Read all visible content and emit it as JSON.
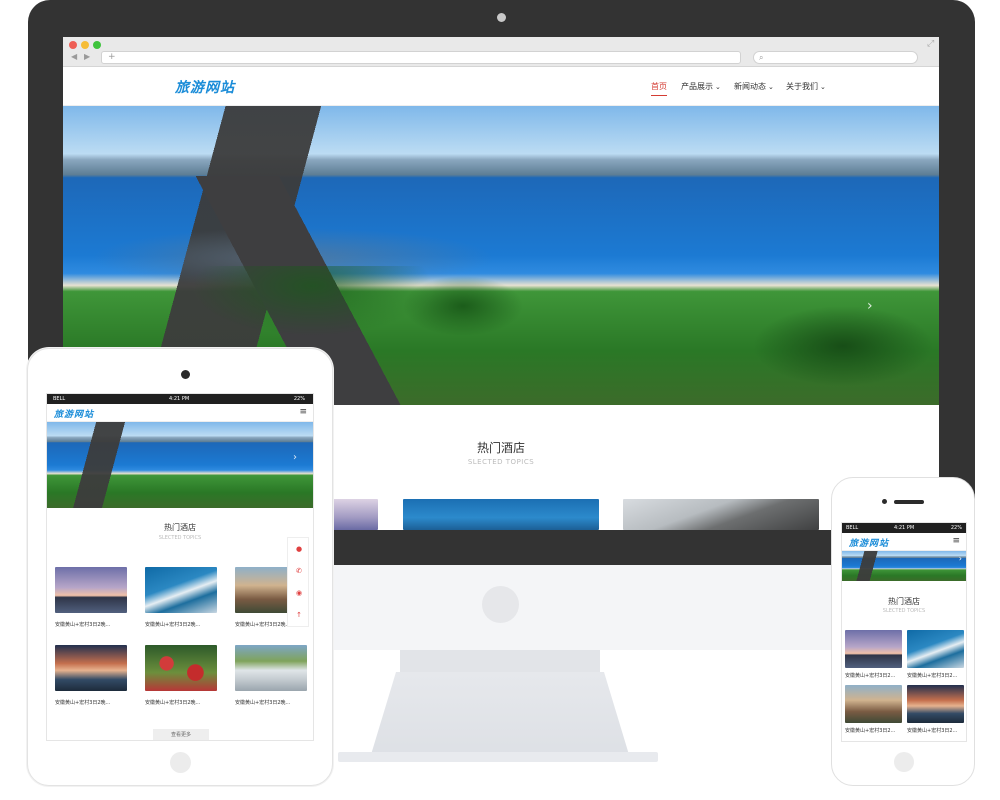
{
  "site": {
    "logo": "旅游网站",
    "nav": [
      {
        "label": "首页",
        "active": true,
        "has_dropdown": false
      },
      {
        "label": "产品展示",
        "active": false,
        "has_dropdown": true
      },
      {
        "label": "新闻动态",
        "active": false,
        "has_dropdown": true
      },
      {
        "label": "关于我们",
        "active": false,
        "has_dropdown": true
      }
    ],
    "section_title": "热门酒店",
    "section_subtitle": "SLECTED TOPICS"
  },
  "browser": {
    "url_placeholder": "+",
    "search_icon": "search-icon",
    "dot_colors": [
      "#ee5f56",
      "#f6bd38",
      "#3fc43d"
    ]
  },
  "status_bar": {
    "carrier": "BELL",
    "time": "4:21 PM",
    "battery": "22%"
  },
  "tablet": {
    "cards": [
      {
        "caption": "安徽黄山+宏村3日2晚..."
      },
      {
        "caption": "安徽黄山+宏村3日2晚..."
      },
      {
        "caption": "安徽黄山+宏村3日2晚..."
      },
      {
        "caption": "安徽黄山+宏村3日2晚..."
      },
      {
        "caption": "安徽黄山+宏村3日2晚..."
      },
      {
        "caption": "安徽黄山+宏村3日2晚..."
      }
    ],
    "more_label": "查看更多",
    "float_icons": [
      "bell-icon",
      "phone-icon",
      "wechat-icon",
      "arrow-up-icon"
    ]
  },
  "phone": {
    "cards": [
      {
        "caption": "安徽黄山+宏村3日2..."
      },
      {
        "caption": "安徽黄山+宏村3日2..."
      },
      {
        "caption": "安徽黄山+宏村3日2..."
      },
      {
        "caption": "安徽黄山+宏村3日2..."
      }
    ]
  },
  "colors": {
    "brand": "#1a8cd8",
    "accent_active": "#d43c33",
    "monitor_bezel": "#333333"
  }
}
